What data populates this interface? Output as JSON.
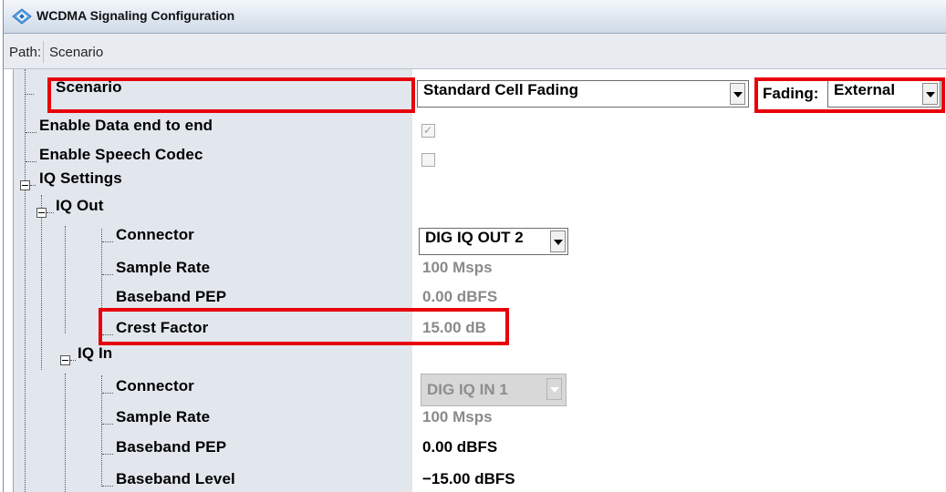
{
  "window": {
    "title": "WCDMA Signaling Configuration",
    "logo_icon": "rohde-schwarz-diamond-icon"
  },
  "path": {
    "label": "Path:",
    "value": "Scenario"
  },
  "tree": {
    "scenario": "Scenario",
    "enable_data_e2e": "Enable Data end to end",
    "enable_speech_codec": "Enable Speech Codec",
    "iq_settings": "IQ Settings",
    "iq_out": "IQ Out",
    "iq_out_connector": "Connector",
    "iq_out_sample_rate": "Sample Rate",
    "iq_out_baseband_pep": "Baseband PEP",
    "iq_out_crest_factor": "Crest Factor",
    "iq_in": "IQ In",
    "iq_in_connector": "Connector",
    "iq_in_sample_rate": "Sample Rate",
    "iq_in_baseband_pep": "Baseband PEP",
    "iq_in_baseband_level": "Baseband Level"
  },
  "values": {
    "scenario_select": "Standard Cell Fading",
    "fading_label": "Fading:",
    "fading_select": "External",
    "enable_data_e2e_checked": true,
    "enable_speech_codec_checked": false,
    "iq_out_connector": "DIG IQ OUT 2",
    "iq_out_sample_rate": "100 Msps",
    "iq_out_baseband_pep": "0.00 dBFS",
    "iq_out_crest_factor": "15.00 dB",
    "iq_in_connector": "DIG IQ IN 1",
    "iq_in_sample_rate": "100 Msps",
    "iq_in_baseband_pep": "0.00 dBFS",
    "iq_in_baseband_level": "−15.00 dBFS"
  },
  "colors": {
    "highlight": "#e8000b",
    "tree_background": "#e2e7ee",
    "disabled_text": "#8a8a8a",
    "focus_line": "#4f8fd6"
  }
}
